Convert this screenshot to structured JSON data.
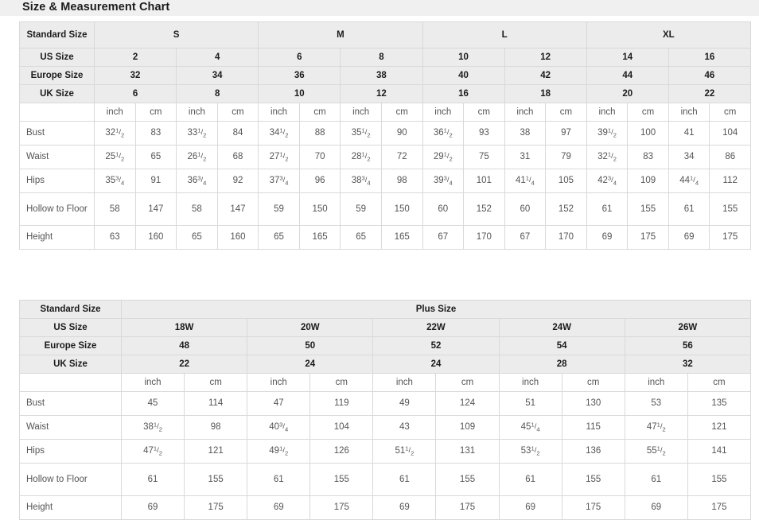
{
  "title": "Size & Measurement Chart",
  "standard_table": {
    "row_label_header": "Standard Size",
    "size_row_labels": [
      "US Size",
      "Europe Size",
      "UK Size"
    ],
    "groups": [
      {
        "label": "S",
        "span": 4
      },
      {
        "label": "M",
        "span": 4
      },
      {
        "label": "L",
        "span": 4
      },
      {
        "label": "XL",
        "span": 4
      }
    ],
    "us_sizes": [
      "2",
      "4",
      "6",
      "8",
      "10",
      "12",
      "14",
      "16"
    ],
    "europe_sizes": [
      "32",
      "34",
      "36",
      "38",
      "40",
      "42",
      "44",
      "46"
    ],
    "uk_sizes": [
      "6",
      "8",
      "10",
      "12",
      "16",
      "18",
      "20",
      "22"
    ],
    "unit_labels": [
      "inch",
      "cm",
      "inch",
      "cm",
      "inch",
      "cm",
      "inch",
      "cm",
      "inch",
      "cm",
      "inch",
      "cm",
      "inch",
      "cm",
      "inch",
      "cm"
    ],
    "unit_inch": "inch",
    "unit_cm": "cm",
    "rows": [
      {
        "label": "Bust",
        "values": [
          {
            "whole": "32",
            "num": "1",
            "den": "2"
          },
          {
            "whole": "83"
          },
          {
            "whole": "33",
            "num": "1",
            "den": "2"
          },
          {
            "whole": "84"
          },
          {
            "whole": "34",
            "num": "1",
            "den": "2"
          },
          {
            "whole": "88"
          },
          {
            "whole": "35",
            "num": "1",
            "den": "2"
          },
          {
            "whole": "90"
          },
          {
            "whole": "36",
            "num": "1",
            "den": "2"
          },
          {
            "whole": "93"
          },
          {
            "whole": "38"
          },
          {
            "whole": "97"
          },
          {
            "whole": "39",
            "num": "1",
            "den": "2"
          },
          {
            "whole": "100"
          },
          {
            "whole": "41"
          },
          {
            "whole": "104"
          }
        ]
      },
      {
        "label": "Waist",
        "values": [
          {
            "whole": "25",
            "num": "1",
            "den": "2"
          },
          {
            "whole": "65"
          },
          {
            "whole": "26",
            "num": "1",
            "den": "2"
          },
          {
            "whole": "68"
          },
          {
            "whole": "27",
            "num": "1",
            "den": "2"
          },
          {
            "whole": "70"
          },
          {
            "whole": "28",
            "num": "1",
            "den": "2"
          },
          {
            "whole": "72"
          },
          {
            "whole": "29",
            "num": "1",
            "den": "2"
          },
          {
            "whole": "75"
          },
          {
            "whole": "31"
          },
          {
            "whole": "79"
          },
          {
            "whole": "32",
            "num": "1",
            "den": "2"
          },
          {
            "whole": "83"
          },
          {
            "whole": "34"
          },
          {
            "whole": "86"
          }
        ]
      },
      {
        "label": "Hips",
        "values": [
          {
            "whole": "35",
            "num": "3",
            "den": "4"
          },
          {
            "whole": "91"
          },
          {
            "whole": "36",
            "num": "3",
            "den": "4"
          },
          {
            "whole": "92"
          },
          {
            "whole": "37",
            "num": "3",
            "den": "4"
          },
          {
            "whole": "96"
          },
          {
            "whole": "38",
            "num": "3",
            "den": "4"
          },
          {
            "whole": "98"
          },
          {
            "whole": "39",
            "num": "3",
            "den": "4"
          },
          {
            "whole": "101"
          },
          {
            "whole": "41",
            "num": "1",
            "den": "4"
          },
          {
            "whole": "105"
          },
          {
            "whole": "42",
            "num": "3",
            "den": "4"
          },
          {
            "whole": "109"
          },
          {
            "whole": "44",
            "num": "1",
            "den": "4"
          },
          {
            "whole": "112"
          }
        ]
      },
      {
        "label": "Hollow to Floor",
        "tall": true,
        "values": [
          {
            "whole": "58"
          },
          {
            "whole": "147"
          },
          {
            "whole": "58"
          },
          {
            "whole": "147"
          },
          {
            "whole": "59"
          },
          {
            "whole": "150"
          },
          {
            "whole": "59"
          },
          {
            "whole": "150"
          },
          {
            "whole": "60"
          },
          {
            "whole": "152"
          },
          {
            "whole": "60"
          },
          {
            "whole": "152"
          },
          {
            "whole": "61"
          },
          {
            "whole": "155"
          },
          {
            "whole": "61"
          },
          {
            "whole": "155"
          }
        ]
      },
      {
        "label": "Height",
        "values": [
          {
            "whole": "63"
          },
          {
            "whole": "160"
          },
          {
            "whole": "65"
          },
          {
            "whole": "160"
          },
          {
            "whole": "65"
          },
          {
            "whole": "165"
          },
          {
            "whole": "65"
          },
          {
            "whole": "165"
          },
          {
            "whole": "67"
          },
          {
            "whole": "170"
          },
          {
            "whole": "67"
          },
          {
            "whole": "170"
          },
          {
            "whole": "69"
          },
          {
            "whole": "175"
          },
          {
            "whole": "69"
          },
          {
            "whole": "175"
          }
        ]
      }
    ]
  },
  "plus_table": {
    "row_label_header": "Standard Size",
    "group_label": "Plus Size",
    "size_row_labels": [
      "US Size",
      "Europe Size",
      "UK Size"
    ],
    "us_sizes": [
      "18W",
      "20W",
      "22W",
      "24W",
      "26W"
    ],
    "europe_sizes": [
      "48",
      "50",
      "52",
      "54",
      "56"
    ],
    "uk_sizes": [
      "22",
      "24",
      "24",
      "28",
      "32"
    ],
    "unit_inch": "inch",
    "unit_cm": "cm",
    "rows": [
      {
        "label": "Bust",
        "values": [
          {
            "whole": "45"
          },
          {
            "whole": "114"
          },
          {
            "whole": "47"
          },
          {
            "whole": "119"
          },
          {
            "whole": "49"
          },
          {
            "whole": "124"
          },
          {
            "whole": "51"
          },
          {
            "whole": "130"
          },
          {
            "whole": "53"
          },
          {
            "whole": "135"
          }
        ]
      },
      {
        "label": "Waist",
        "values": [
          {
            "whole": "38",
            "num": "1",
            "den": "2"
          },
          {
            "whole": "98"
          },
          {
            "whole": "40",
            "num": "3",
            "den": "4"
          },
          {
            "whole": "104"
          },
          {
            "whole": "43"
          },
          {
            "whole": "109"
          },
          {
            "whole": "45",
            "num": "1",
            "den": "4"
          },
          {
            "whole": "115"
          },
          {
            "whole": "47",
            "num": "1",
            "den": "2"
          },
          {
            "whole": "121"
          }
        ]
      },
      {
        "label": "Hips",
        "values": [
          {
            "whole": "47",
            "num": "1",
            "den": "2"
          },
          {
            "whole": "121"
          },
          {
            "whole": "49",
            "num": "1",
            "den": "2"
          },
          {
            "whole": "126"
          },
          {
            "whole": "51",
            "num": "1",
            "den": "2"
          },
          {
            "whole": "131"
          },
          {
            "whole": "53",
            "num": "1",
            "den": "2"
          },
          {
            "whole": "136"
          },
          {
            "whole": "55",
            "num": "1",
            "den": "2"
          },
          {
            "whole": "141"
          }
        ]
      },
      {
        "label": "Hollow to Floor",
        "tall": true,
        "values": [
          {
            "whole": "61"
          },
          {
            "whole": "155"
          },
          {
            "whole": "61"
          },
          {
            "whole": "155"
          },
          {
            "whole": "61"
          },
          {
            "whole": "155"
          },
          {
            "whole": "61"
          },
          {
            "whole": "155"
          },
          {
            "whole": "61"
          },
          {
            "whole": "155"
          }
        ]
      },
      {
        "label": "Height",
        "values": [
          {
            "whole": "69"
          },
          {
            "whole": "175"
          },
          {
            "whole": "69"
          },
          {
            "whole": "175"
          },
          {
            "whole": "69"
          },
          {
            "whole": "175"
          },
          {
            "whole": "69"
          },
          {
            "whole": "175"
          },
          {
            "whole": "69"
          },
          {
            "whole": "175"
          }
        ]
      }
    ]
  }
}
